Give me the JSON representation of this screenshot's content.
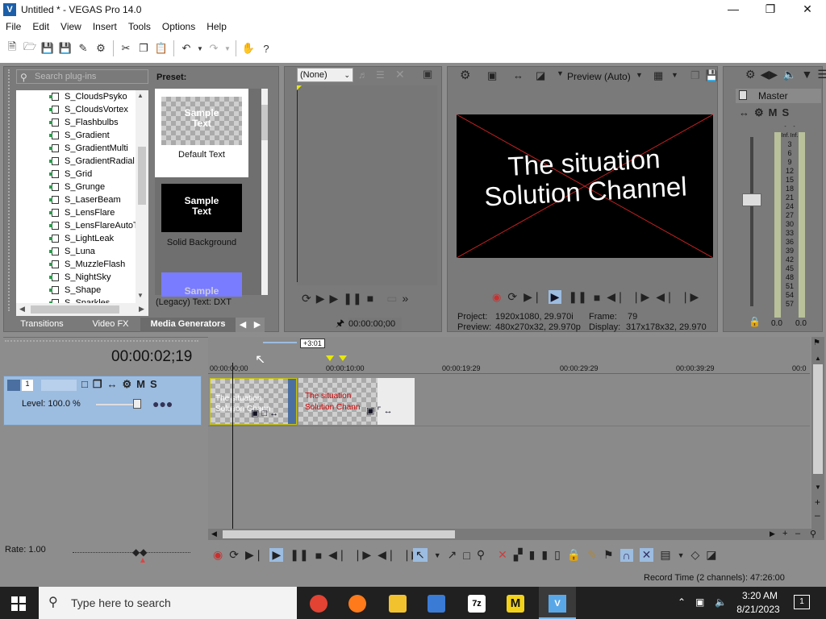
{
  "window": {
    "title": "Untitled * - VEGAS Pro 14.0"
  },
  "menu": [
    "File",
    "Edit",
    "View",
    "Insert",
    "Tools",
    "Options",
    "Help"
  ],
  "plugins": {
    "search_placeholder": "Search plug-ins",
    "items": [
      "S_CloudsPsyko",
      "S_CloudsVortex",
      "S_Flashbulbs",
      "S_Gradient",
      "S_GradientMulti",
      "S_GradientRadial",
      "S_Grid",
      "S_Grunge",
      "S_LaserBeam",
      "S_LensFlare",
      "S_LensFlareAutoT",
      "S_LightLeak",
      "S_Luna",
      "S_MuzzleFlash",
      "S_NightSky",
      "S_Shape",
      "S_Sparkles"
    ]
  },
  "preset": {
    "label": "Preset:",
    "items": [
      {
        "thumb": "Sample\nText",
        "name": "Default Text"
      },
      {
        "thumb": "Sample\nText",
        "name": "Solid Background"
      },
      {
        "thumb": "Sample",
        "name": ""
      }
    ],
    "footer": "(Legacy) Text: DXT"
  },
  "tabs": [
    "Transitions",
    "Video FX",
    "Media Generators"
  ],
  "trimmer": {
    "dropdown": "(None)",
    "time": "00:00:00;00"
  },
  "preview": {
    "mode": "Preview (Auto)",
    "text_line1": "The situation",
    "text_line2": "Solution Channel",
    "project_label": "Project:",
    "project_value": "1920x1080, 29.970i",
    "frame_label": "Frame:",
    "frame_value": "79",
    "preview_label": "Preview:",
    "preview_value": "480x270x32, 29.970p",
    "display_label": "Display:",
    "display_value": "317x178x32, 29.970"
  },
  "master": {
    "label": "Master",
    "scale": [
      "-Inf.",
      "-Inf.",
      "3",
      "6",
      "9",
      "12",
      "15",
      "18",
      "21",
      "24",
      "27",
      "30",
      "33",
      "36",
      "39",
      "42",
      "45",
      "48",
      "51",
      "54",
      "57"
    ],
    "left_value": "0.0",
    "right_value": "0.0"
  },
  "timeline": {
    "current_time": "00:00:02;19",
    "marker_label": "+3:01",
    "ruler": [
      "00:00:00;00",
      "00:00:10:00",
      "00:00:19:29",
      "00:00:29:29",
      "00:00:39:29",
      "00:0"
    ],
    "track_number": "1",
    "track_level": "Level: 100.0 %",
    "clip1_text_1": "The situation",
    "clip1_text_2": "Solution Chann",
    "clip2_text_1": "The situation",
    "clip2_text_2": "Solution Chann",
    "rate": "Rate: 1.00",
    "record_time": "Record Time (2 channels): 47:26:00"
  },
  "taskbar": {
    "search_placeholder": "Type here to search",
    "time": "3:20 AM",
    "date": "8/21/2023",
    "notification_count": "1"
  }
}
